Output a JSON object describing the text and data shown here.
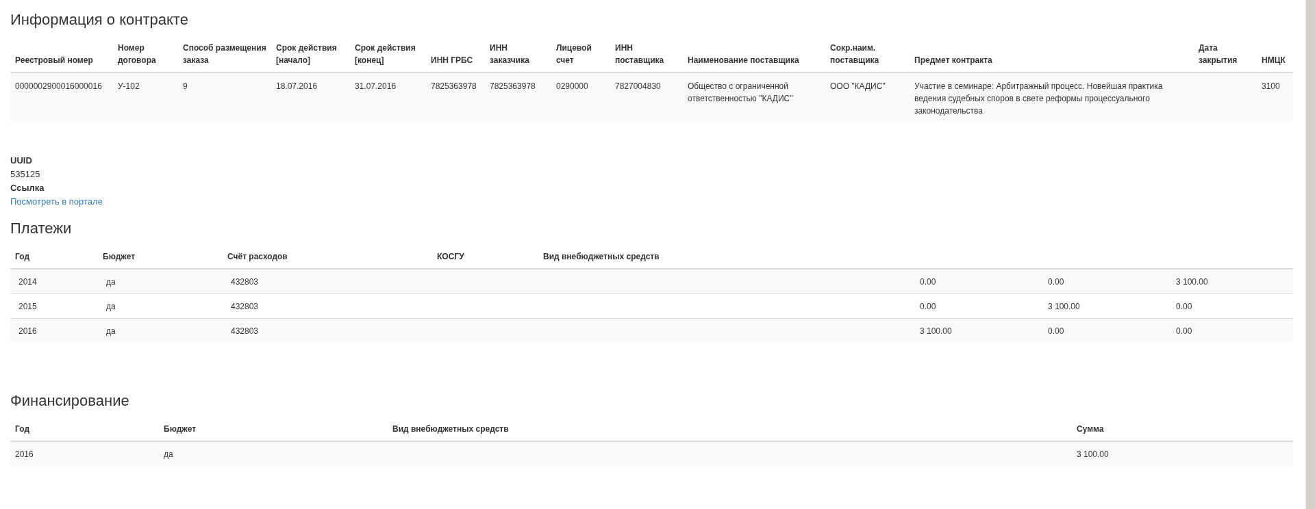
{
  "contract": {
    "title": "Информация о контракте",
    "columns": [
      "Реестровый номер",
      "Номер договора",
      "Способ размещения заказа",
      "Срок действия [начало]",
      "Срок действия [конец]",
      "ИНН ГРБС",
      "ИНН заказчика",
      "Лицевой счет",
      "ИНН поставщика",
      "Наименование поставщика",
      "Сокр.наим. поставщика",
      "Предмет контракта",
      "Дата закрытия",
      "НМЦК"
    ],
    "rows": [
      [
        "0000002900016000016",
        "У-102",
        "9",
        "18.07.2016",
        "31.07.2016",
        "7825363978",
        "7825363978",
        "0290000",
        "7827004830",
        "Общество с ограниченной ответственностью \"КАДИС\"",
        "ООО \"КАДИС\"",
        "Участие в семинаре: Арбитражный процесс. Новейшая практика ведения судебных споров в свете реформы процессуального законодательства",
        "",
        "3100"
      ]
    ]
  },
  "details": [
    {
      "label": "UUID",
      "value": "535125",
      "kind": "text"
    },
    {
      "label": "Ссылка",
      "value": "Посмотреть в портале",
      "kind": "link"
    }
  ],
  "payments": {
    "title": "Платежи",
    "columns": [
      "Год",
      "Бюджет",
      "Счёт расходов",
      "КОСГУ",
      "Вид внебюджетных средств",
      "",
      "",
      ""
    ],
    "rows": [
      [
        "2014",
        "да",
        "432803",
        "",
        "",
        "0.00",
        "0.00",
        "3 100.00"
      ],
      [
        "2015",
        "да",
        "432803",
        "",
        "",
        "0.00",
        "3 100.00",
        "0.00"
      ],
      [
        "2016",
        "да",
        "432803",
        "",
        "",
        "3 100.00",
        "0.00",
        "0.00"
      ]
    ]
  },
  "financing": {
    "title": "Финансирование",
    "columns": [
      "Год",
      "Бюджет",
      "Вид внебюджетных средств",
      "Сумма"
    ],
    "rows": [
      [
        "2016",
        "да",
        "",
        "3 100.00"
      ]
    ]
  }
}
